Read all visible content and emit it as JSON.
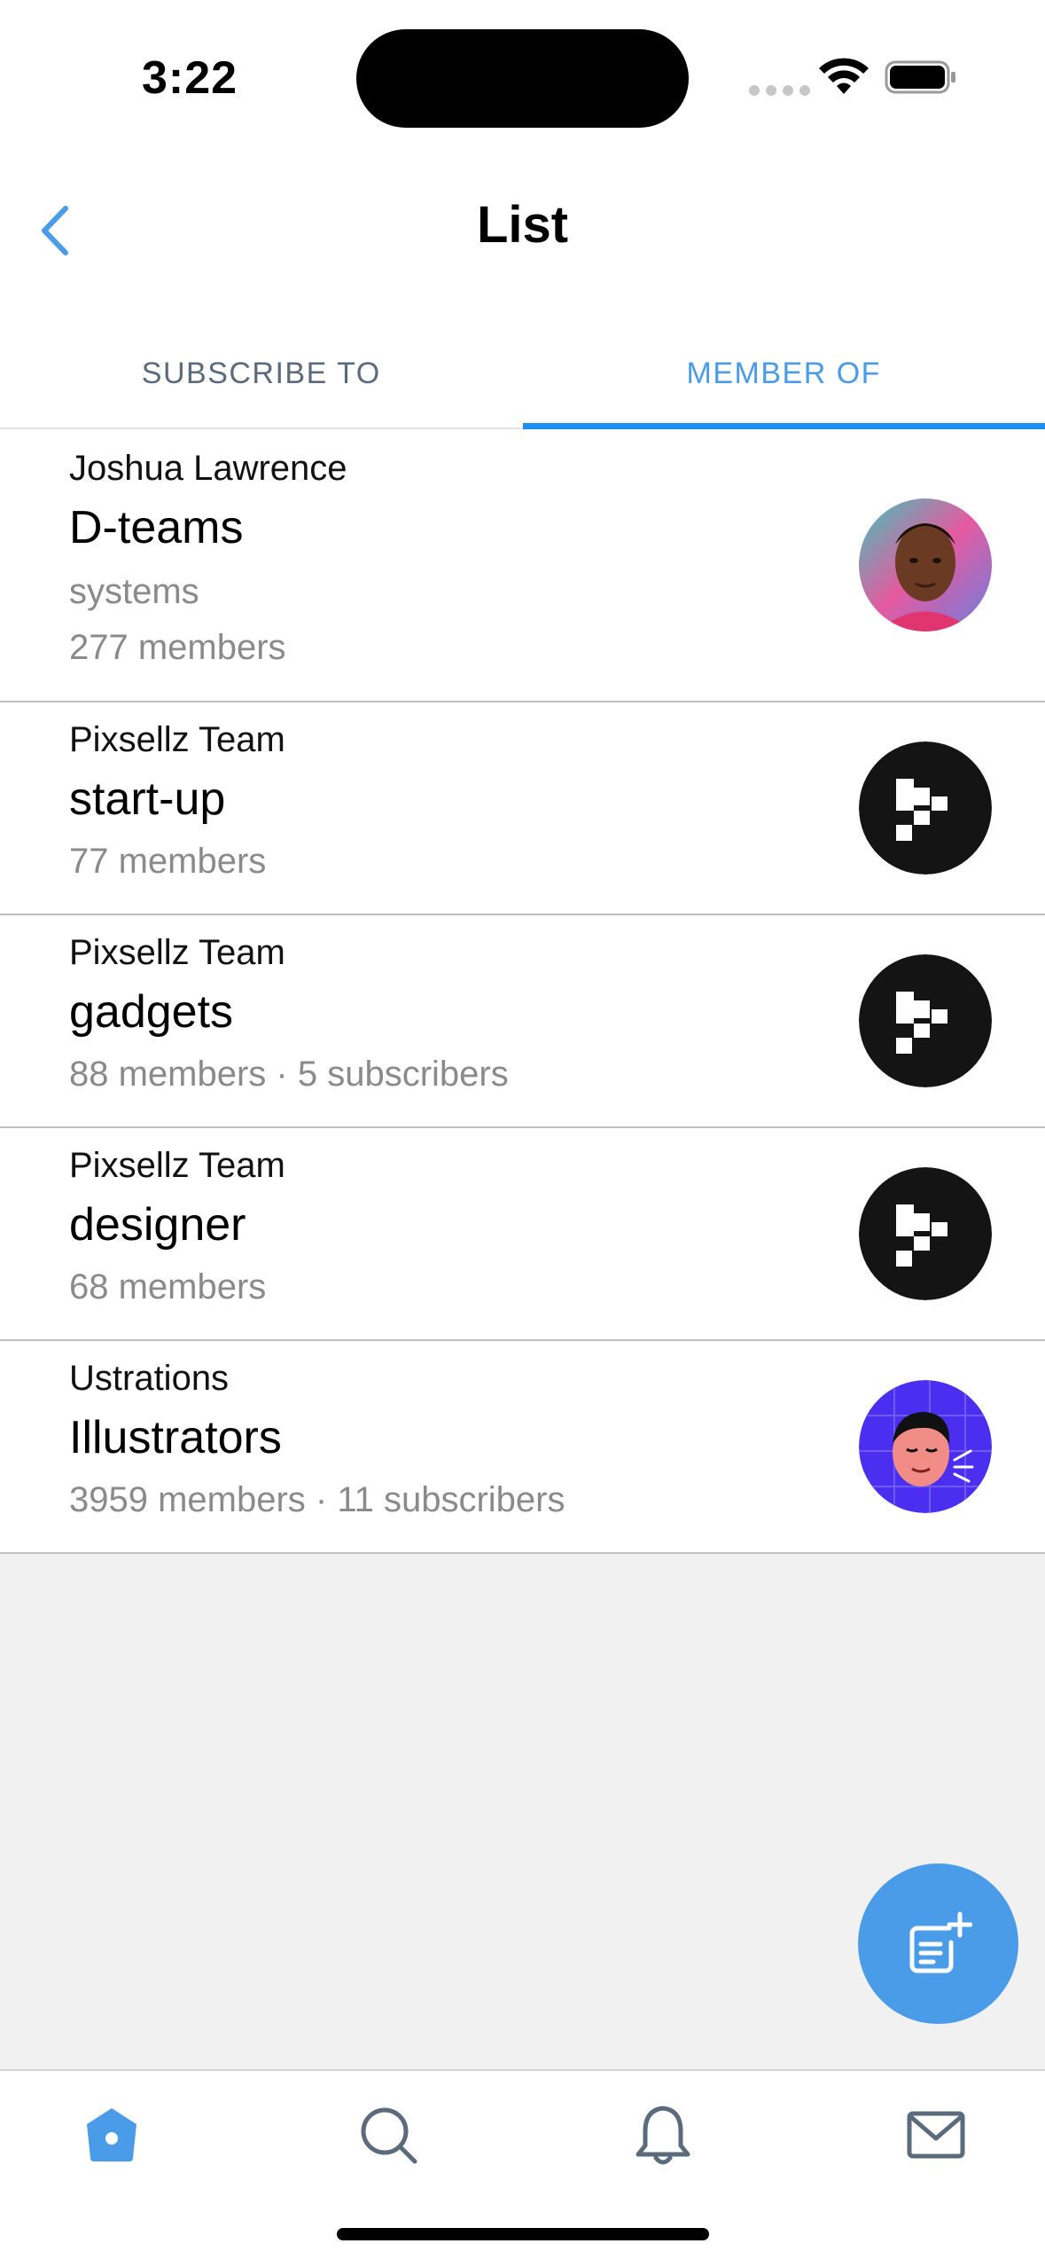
{
  "status": {
    "time": "3:22"
  },
  "header": {
    "title": "List"
  },
  "tabs": [
    {
      "label": "SUBSCRIBE TO",
      "active": false
    },
    {
      "label": "MEMBER OF",
      "active": true
    }
  ],
  "lists": [
    {
      "owner": "Joshua Lawrence",
      "name": "D-teams",
      "description": "systems",
      "meta": "277 members",
      "avatar": "person-photo"
    },
    {
      "owner": "Pixsellz Team",
      "name": "start-up",
      "description": "",
      "meta": "77 members",
      "avatar": "pixsellz-logo"
    },
    {
      "owner": "Pixsellz Team",
      "name": "gadgets",
      "description": "",
      "meta": "88 members · 5 subscribers",
      "avatar": "pixsellz-logo"
    },
    {
      "owner": "Pixsellz Team",
      "name": "designer",
      "description": "",
      "meta": "68 members",
      "avatar": "pixsellz-logo"
    },
    {
      "owner": "Ustrations",
      "name": "Illustrators",
      "description": "",
      "meta": "3959 members · 11 subscribers",
      "avatar": "illustrated-face"
    }
  ],
  "fab": {
    "icon": "new-list-icon"
  },
  "tabbar": {
    "icons": [
      "home-icon",
      "search-icon",
      "bell-icon",
      "mail-icon"
    ]
  },
  "colors": {
    "accent": "#4a9be8",
    "tab_underline": "#1d8cf0",
    "muted": "#8a8a8a",
    "background": "#f1f1f1"
  }
}
